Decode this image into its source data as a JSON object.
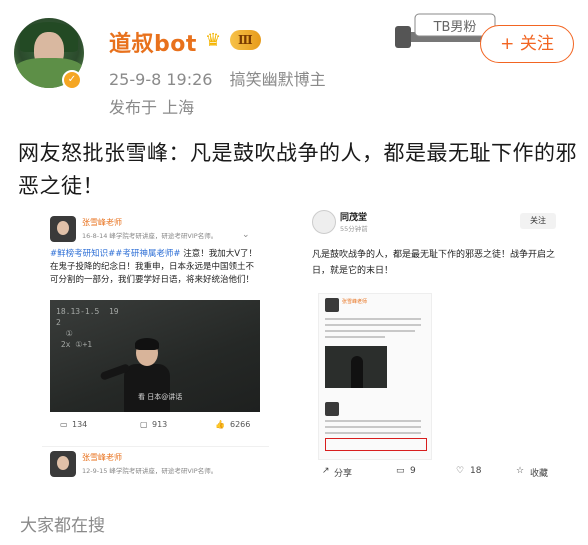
{
  "header": {
    "username": "道叔bot",
    "vip_level": "Ⅲ",
    "date": "25-9-8 19:26",
    "category": "搞笑幽默博主",
    "location": "发布于 上海",
    "fan_badge": "TB男粉",
    "follow_label": "+ 关注"
  },
  "post": {
    "text": "网友怒批张雪峰：凡是鼓吹战争的人，都是最无耻下作的邪恶之徒！"
  },
  "left_card": {
    "name": "张雪峰老师",
    "meta": "16-8-14   峰学院考研讲座，研途考研VIP名师。",
    "body_hash": "#鲜榜考研知识##考研神属老师#",
    "body_rest": " 注意！我加大V了！在鬼子投降的纪念日！我重申，日本永远是中国领土不可分割的一部分，我们要学好日语，将来好统治他们！",
    "chalk": "18.13-1.5  19\n2\n  ①\n 2x ①+1",
    "watermark": "看 日本@讲话",
    "comments": "134",
    "reposts": "913",
    "likes": "6266",
    "name2": "张雪峰老师",
    "meta2": "12-9-15   峰学院考研讲座，研途考研VIP名师。"
  },
  "right_card": {
    "name": "同茂堂",
    "time": "55分钟前",
    "follow": "关注",
    "text": "凡是鼓吹战争的人，都是最无耻下作的邪恶之徒！战争开启之日，就是它的末日！",
    "nested_name": "张雪峰老师",
    "share": "分享",
    "comments": "9",
    "likes": "18",
    "collect": "收藏"
  },
  "footer": {
    "search_label": "大家都在搜"
  },
  "colors": {
    "accent_orange": "#f26522",
    "username_orange": "#e8711c",
    "meta_gray": "#8a8a8a"
  }
}
